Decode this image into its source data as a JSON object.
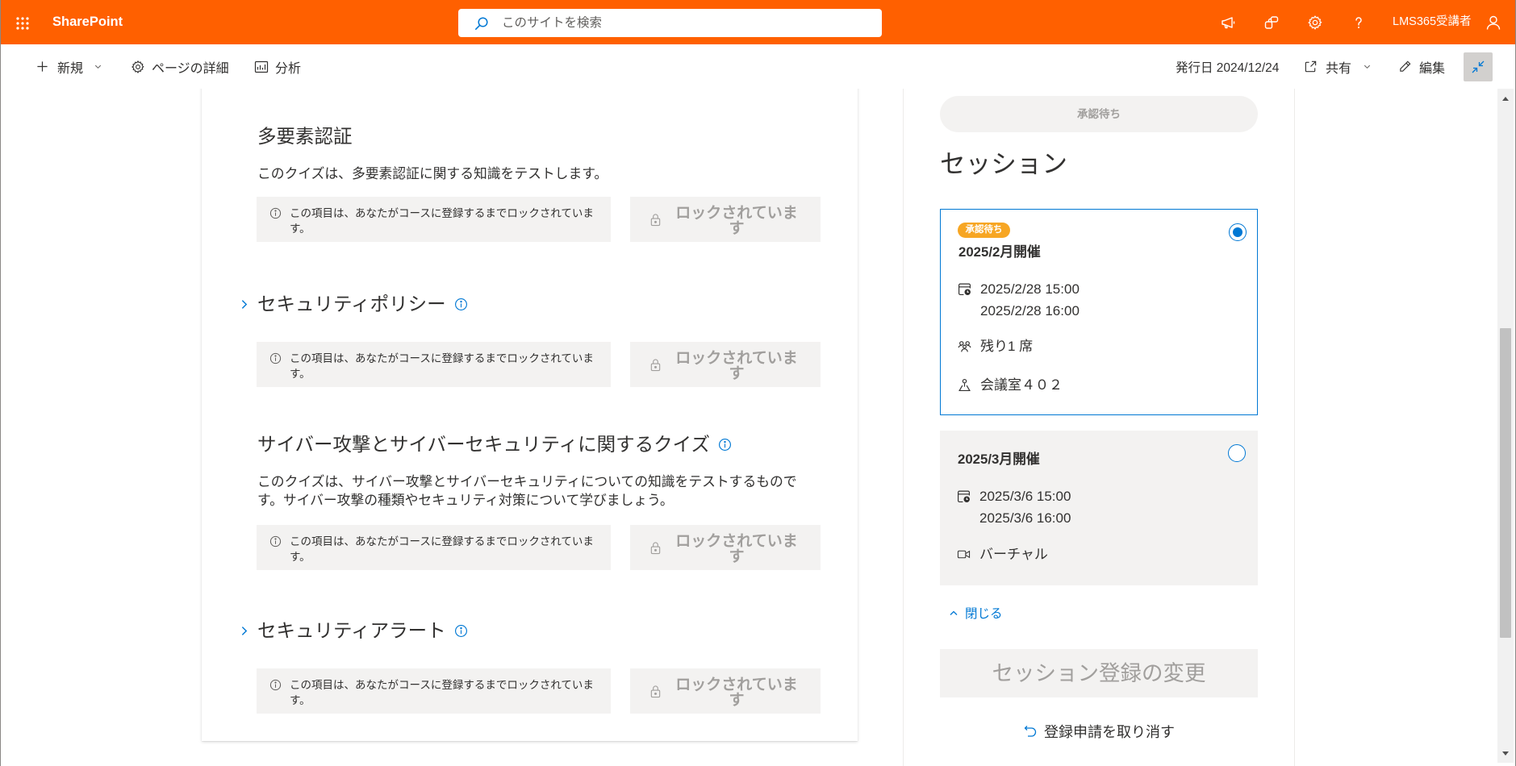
{
  "app": {
    "title": "SharePoint"
  },
  "search": {
    "placeholder": "このサイトを検索"
  },
  "header": {
    "user_name": "LMS365受講者"
  },
  "command_bar": {
    "new": "新規",
    "page_details": "ページの詳細",
    "analytics": "分析",
    "published": "発行日 2024/12/24",
    "share": "共有",
    "edit": "編集"
  },
  "quizzes": [
    {
      "title": "多要素認証",
      "description": "このクイズは、多要素認証に関する知識をテストします。",
      "lock_message": "この項目は、あなたがコースに登録するまでロックされています。",
      "lock_button": "ロックされています"
    },
    {
      "title": "セキュリティポリシー",
      "lock_message": "この項目は、あなたがコースに登録するまでロックされています。",
      "lock_button": "ロックされています"
    },
    {
      "title": "サイバー攻撃とサイバーセキュリティに関するクイズ",
      "description": "このクイズは、サイバー攻撃とサイバーセキュリティについての知識をテストするものです。サイバー攻撃の種類やセキュリティ対策について学びましょう。",
      "lock_message": "この項目は、あなたがコースに登録するまでロックされています。",
      "lock_button": "ロックされています"
    },
    {
      "title": "セキュリティアラート",
      "lock_message": "この項目は、あなたがコースに登録するまでロックされています。",
      "lock_button": "ロックされています"
    }
  ],
  "session_panel": {
    "status_pill": "承認待ち",
    "heading": "セッション",
    "sessions": [
      {
        "badge": "承認待ち",
        "title": "2025/2月開催",
        "start": "2025/2/28 15:00",
        "end": "2025/2/28 16:00",
        "seats": "残り1 席",
        "location": "会議室４０２",
        "selected": true
      },
      {
        "title": "2025/3月開催",
        "start": "2025/3/6 15:00",
        "end": "2025/3/6 16:00",
        "location": "バーチャル",
        "selected": false
      }
    ],
    "collapse_label": "閉じる",
    "change_button": "セッション登録の変更",
    "cancel_link": "登録申請を取り消す"
  },
  "colors": {
    "suite_bar": "#ff6000",
    "accent": "#0078d4",
    "badge": "#f7a623"
  }
}
